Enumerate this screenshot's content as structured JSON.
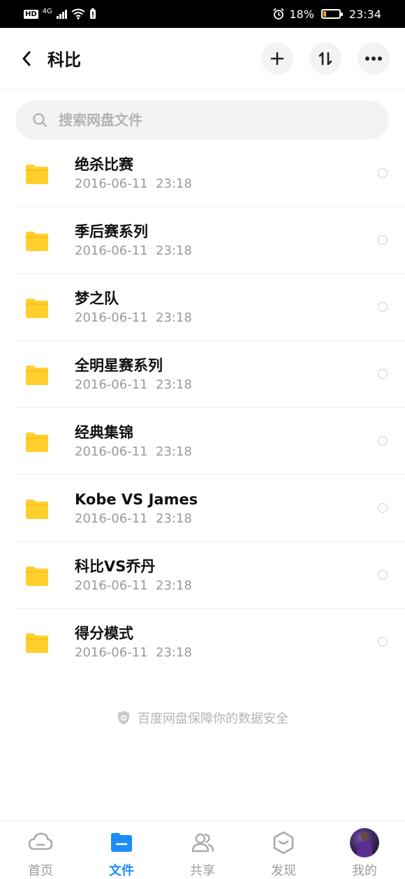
{
  "status_bar": {
    "hd": "HD",
    "network": "4G",
    "battery_percent": "18%",
    "battery_level": 0.18,
    "time": "23:34",
    "battery_color": "#ff9a1b"
  },
  "header": {
    "title": "科比",
    "back_icon": "chevron-left-icon",
    "add_icon": "plus-icon",
    "sort_icon": "sort-icon",
    "more_icon": "more-icon"
  },
  "search": {
    "placeholder": "搜索网盘文件"
  },
  "files": [
    {
      "name": "绝杀比赛",
      "date": "2016-06-11  23:18"
    },
    {
      "name": "季后赛系列",
      "date": "2016-06-11  23:18"
    },
    {
      "name": "梦之队",
      "date": "2016-06-11  23:18"
    },
    {
      "name": "全明星赛系列",
      "date": "2016-06-11  23:18"
    },
    {
      "name": "经典集锦",
      "date": "2016-06-11  23:18"
    },
    {
      "name": "Kobe VS James",
      "date": "2016-06-11  23:18"
    },
    {
      "name": "科比VS乔丹",
      "date": "2016-06-11  23:18"
    },
    {
      "name": "得分模式",
      "date": "2016-06-11  23:18"
    }
  ],
  "footer_note": "百度网盘保障你的数据安全",
  "bottom_nav": [
    {
      "label": "首页",
      "icon": "cloud-icon",
      "active": false
    },
    {
      "label": "文件",
      "icon": "folder-icon",
      "active": true
    },
    {
      "label": "共享",
      "icon": "people-icon",
      "active": false
    },
    {
      "label": "发现",
      "icon": "discover-icon",
      "active": false
    },
    {
      "label": "我的",
      "icon": "avatar",
      "active": false
    }
  ],
  "colors": {
    "accent": "#1d8cf8",
    "folder": "#ffcf2e"
  }
}
